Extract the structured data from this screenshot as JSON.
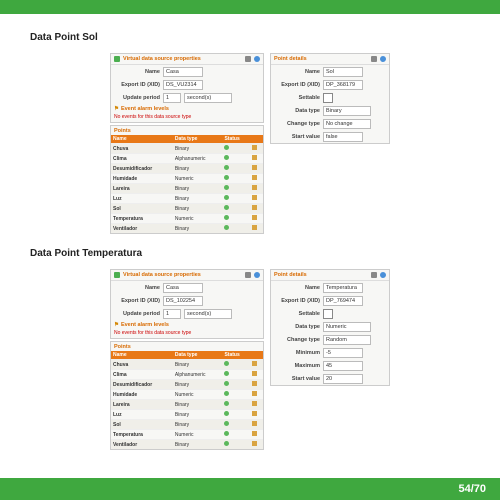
{
  "page_counter": "54/70",
  "sections": {
    "sol": {
      "heading": "Data Point Sol",
      "src_props": {
        "title": "Virtual data source properties",
        "name_lbl": "Name",
        "name_val": "Casa",
        "xid_lbl": "Export ID (XID)",
        "xid_val": "DS_VU2314",
        "period_lbl": "Update period",
        "period_num": "1",
        "period_unit": "second(s)"
      },
      "alarm_title": "Event alarm levels",
      "no_events": "No events for this data source type",
      "points_title": "Points",
      "cols": {
        "name": "Name",
        "dt": "Data type",
        "st": "Status"
      },
      "rows": [
        {
          "n": "Chuva",
          "t": "Binary"
        },
        {
          "n": "Clima",
          "t": "Alphanumeric"
        },
        {
          "n": "Desumidificador",
          "t": "Binary"
        },
        {
          "n": "Humidade",
          "t": "Numeric"
        },
        {
          "n": "Lareira",
          "t": "Binary"
        },
        {
          "n": "Luz",
          "t": "Binary"
        },
        {
          "n": "Sol",
          "t": "Binary"
        },
        {
          "n": "Temperatura",
          "t": "Numeric"
        },
        {
          "n": "Ventilador",
          "t": "Binary"
        }
      ],
      "details": {
        "title": "Point details",
        "name_lbl": "Name",
        "name_val": "Sol",
        "xid_lbl": "Export ID (XID)",
        "xid_val": "DP_368179",
        "settable_lbl": "Settable",
        "dtype_lbl": "Data type",
        "dtype_val": "Binary",
        "ctype_lbl": "Change type",
        "ctype_val": "No change",
        "sval_lbl": "Start value",
        "sval_val": "false"
      }
    },
    "temp": {
      "heading": "Data Point Temperatura",
      "src_props": {
        "title": "Virtual data source properties",
        "name_lbl": "Name",
        "name_val": "Casa",
        "xid_lbl": "Export ID (XID)",
        "xid_val": "DS_102254",
        "period_lbl": "Update period",
        "period_num": "1",
        "period_unit": "second(s)"
      },
      "alarm_title": "Event alarm levels",
      "no_events": "No events for this data source type",
      "points_title": "Points",
      "cols": {
        "name": "Name",
        "dt": "Data type",
        "st": "Status"
      },
      "rows": [
        {
          "n": "Chuva",
          "t": "Binary"
        },
        {
          "n": "Clima",
          "t": "Alphanumeric"
        },
        {
          "n": "Desumidificador",
          "t": "Binary"
        },
        {
          "n": "Humidade",
          "t": "Numeric"
        },
        {
          "n": "Lareira",
          "t": "Binary"
        },
        {
          "n": "Luz",
          "t": "Binary"
        },
        {
          "n": "Sol",
          "t": "Binary"
        },
        {
          "n": "Temperatura",
          "t": "Numeric"
        },
        {
          "n": "Ventilador",
          "t": "Binary"
        }
      ],
      "details": {
        "title": "Point details",
        "name_lbl": "Name",
        "name_val": "Temperatura",
        "xid_lbl": "Export ID (XID)",
        "xid_val": "DP_769474",
        "settable_lbl": "Settable",
        "dtype_lbl": "Data type",
        "dtype_val": "Numeric",
        "ctype_lbl": "Change type",
        "ctype_val": "Random",
        "min_lbl": "Minimum",
        "min_val": "-5",
        "max_lbl": "Maximum",
        "max_val": "45",
        "sval_lbl": "Start value",
        "sval_val": "20"
      }
    }
  }
}
